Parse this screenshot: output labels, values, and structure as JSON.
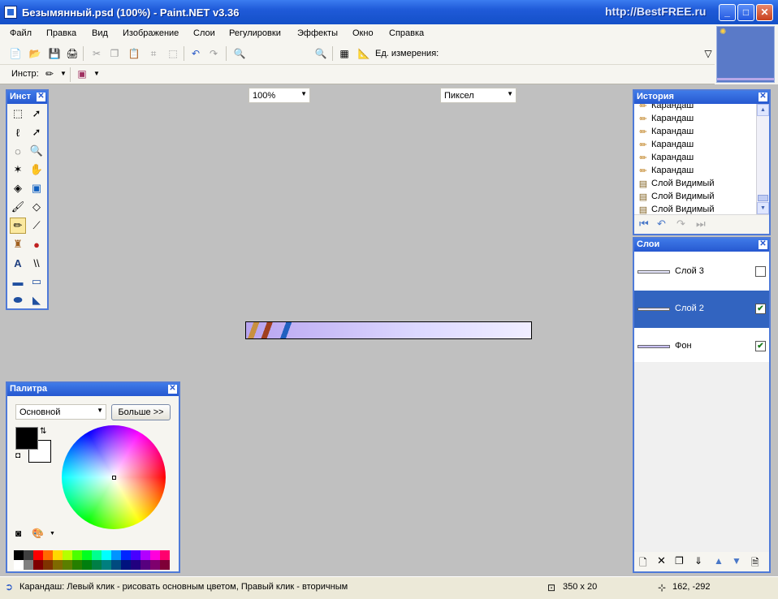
{
  "window": {
    "title": "Безымянный.psd (100%) - Paint.NET v3.36",
    "brand": "http://BestFREE.ru"
  },
  "menu": [
    "Файл",
    "Правка",
    "Вид",
    "Изображение",
    "Слои",
    "Регулировки",
    "Эффекты",
    "Окно",
    "Справка"
  ],
  "toolbar": {
    "zoom_value": "100%",
    "units_label": "Ед. измерения:",
    "units_value": "Пиксел",
    "tool_label": "Инстр:"
  },
  "tools_panel": {
    "title": "Инст"
  },
  "history": {
    "title": "История",
    "items": [
      {
        "icon": "pencil-icon",
        "label": "Карандаш"
      },
      {
        "icon": "pencil-icon",
        "label": "Карандаш"
      },
      {
        "icon": "pencil-icon",
        "label": "Карандаш"
      },
      {
        "icon": "pencil-icon",
        "label": "Карандаш"
      },
      {
        "icon": "pencil-icon",
        "label": "Карандаш"
      },
      {
        "icon": "pencil-icon",
        "label": "Карандаш"
      },
      {
        "icon": "layer-visible-icon",
        "label": "Слой Видимый"
      },
      {
        "icon": "layer-visible-icon",
        "label": "Слой Видимый"
      },
      {
        "icon": "layer-visible-icon",
        "label": "Слой Видимый"
      }
    ]
  },
  "layers": {
    "title": "Слои",
    "items": [
      {
        "name": "Слой 3",
        "visible": false
      },
      {
        "name": "Слой 2",
        "visible": true,
        "selected": true
      },
      {
        "name": "Фон",
        "visible": true
      }
    ]
  },
  "palette": {
    "title": "Палитра",
    "mode": "Основной",
    "more_button": "Больше >>",
    "colors": [
      "#000000",
      "#404040",
      "#ff0000",
      "#ff6a00",
      "#ffd800",
      "#b6ff00",
      "#4cff00",
      "#00ff21",
      "#00ff90",
      "#00ffff",
      "#0094ff",
      "#0026ff",
      "#4800ff",
      "#b200ff",
      "#ff00dc",
      "#ff006e",
      "#ffffff",
      "#808080",
      "#7f0000",
      "#7f3300",
      "#7f6a00",
      "#5b7f00",
      "#267f00",
      "#007f0e",
      "#007f46",
      "#007f7f",
      "#004a7f",
      "#00137f",
      "#21007f",
      "#57007f",
      "#7f006e",
      "#7f0037"
    ]
  },
  "status": {
    "message": "Карандаш: Левый клик - рисовать основным цветом, Правый клик - вторичным",
    "size": "350 x 20",
    "cursor": "162, -292"
  }
}
